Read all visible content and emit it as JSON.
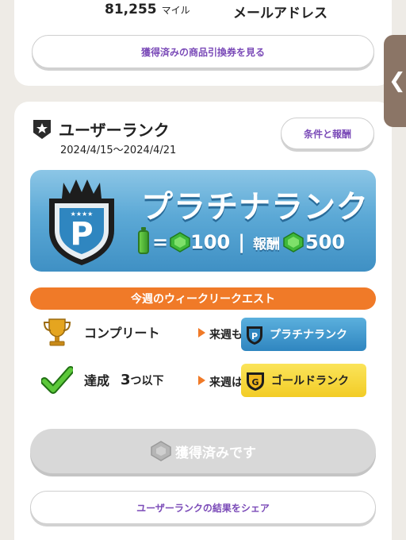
{
  "header": {
    "miles_value": "81,255",
    "miles_unit": "マイル",
    "mail_label": "メールアドレス",
    "coupon_button": "獲得済みの商品引換券を見る"
  },
  "rank": {
    "title": "ユーザーランク",
    "dates": "2024/4/15～2024/4/21",
    "conditions_button": "条件と報酬",
    "banner": {
      "rank_name": "プラチナランク",
      "equals": "=",
      "gem_rate": "100",
      "divider": "|",
      "reward_label": "報酬",
      "reward_value": "500",
      "emblem_letter": "P"
    },
    "quest_title": "今週のウィークリークエスト",
    "rows": [
      {
        "label": "コンプリート",
        "next_label": "来週も",
        "next_rank": "プラチナランク",
        "icon": "trophy-icon"
      },
      {
        "label": "達成",
        "count": "3",
        "count_suffix": "つ以下",
        "next_label": "来週は",
        "next_rank": "ゴールドランク",
        "icon": "checkmark-icon"
      }
    ],
    "claimed_button": "獲得済みです",
    "share_button": "ユーザーランクの結果をシェア"
  },
  "side_tab": {
    "icon": "chevron-left-icon",
    "glyph": "❮"
  },
  "colors": {
    "accent_purple": "#7b4bb8",
    "quest_orange": "#f07a28",
    "platinum_blue": "#3f90c4",
    "gold": "#f2cc26"
  }
}
